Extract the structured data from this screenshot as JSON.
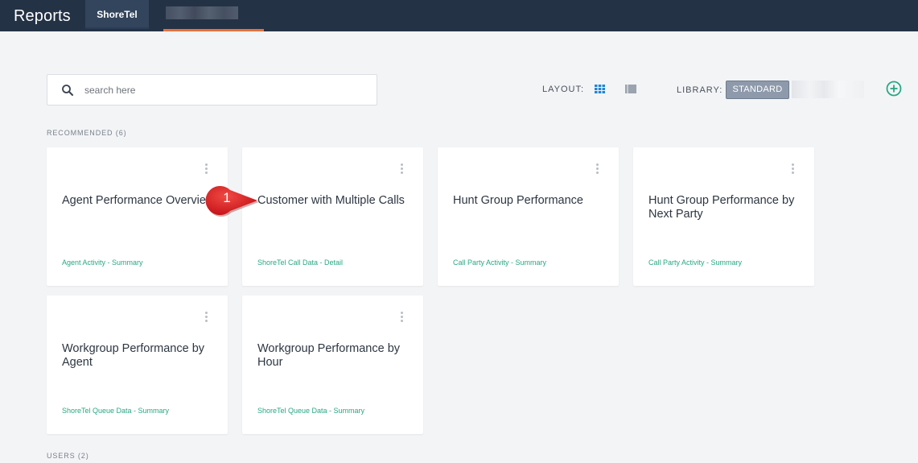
{
  "header": {
    "app_title": "Reports",
    "tab_active": "ShoreTel"
  },
  "search": {
    "placeholder": "search here",
    "value": ""
  },
  "toolbar": {
    "layout_label": "LAYOUT:",
    "library_label": "LIBRARY:",
    "standard_label": "STANDARD",
    "layout_selected": "grid",
    "icons": [
      "search-icon",
      "grid-view-icon",
      "list-view-icon",
      "add-circle-icon",
      "more-vertical-icon"
    ]
  },
  "sections": {
    "recommended": "RECOMMENDED (6)",
    "users": "USERS (2)"
  },
  "cards": [
    {
      "title": "Agent Performance Overview",
      "subtitle": "Agent Activity - Summary"
    },
    {
      "title": "Customer with Multiple Calls",
      "subtitle": "ShoreTel Call Data - Detail"
    },
    {
      "title": "Hunt Group Performance",
      "subtitle": "Call Party Activity - Summary"
    },
    {
      "title": "Hunt Group Performance by Next Party",
      "subtitle": "Call Party Activity - Summary"
    },
    {
      "title": "Workgroup Performance by Agent",
      "subtitle": "ShoreTel Queue Data - Summary"
    },
    {
      "title": "Workgroup Performance by Hour",
      "subtitle": "ShoreTel Queue Data - Summary"
    }
  ],
  "callout": {
    "number": "1"
  },
  "colors": {
    "topbar": "#243246",
    "accent_green": "#28a783",
    "tab_underline": "#e8713a",
    "grid_icon_active": "#1f86d6",
    "callout_red": "#e0272a"
  }
}
